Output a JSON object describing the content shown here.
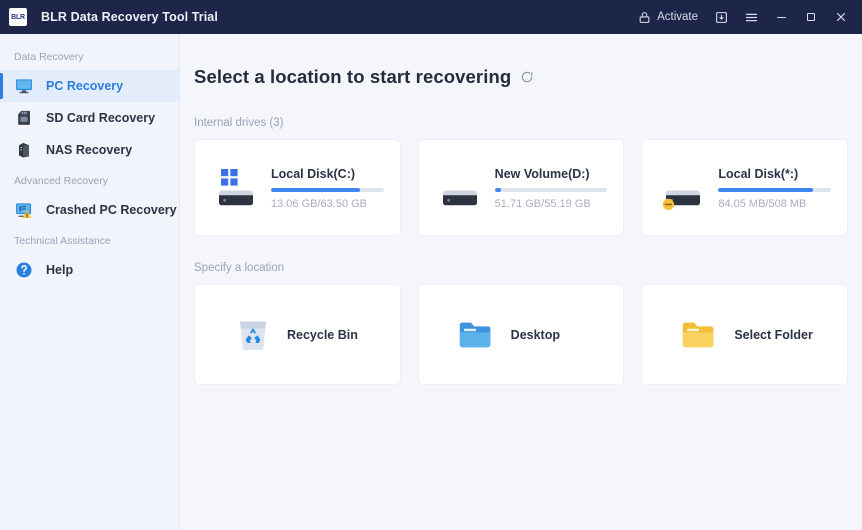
{
  "window": {
    "logo_text": "BLR",
    "title": "BLR Data Recovery Tool Trial",
    "titlebar_bg": "#1d2548",
    "activate_label": "Activate",
    "icons": {
      "lock": "lock-icon",
      "download": "download-icon",
      "menu": "hamburger-menu-icon",
      "minimize": "minimize-icon",
      "maximize": "maximize-icon",
      "close": "close-icon"
    }
  },
  "sidebar": {
    "groups": [
      {
        "label": "Data Recovery",
        "items": [
          {
            "label": "PC Recovery",
            "icon": "monitor-icon",
            "active": true
          },
          {
            "label": "SD Card Recovery",
            "icon": "sd-card-icon",
            "active": false
          },
          {
            "label": "NAS Recovery",
            "icon": "nas-server-icon",
            "active": false
          }
        ]
      },
      {
        "label": "Advanced Recovery",
        "items": [
          {
            "label": "Crashed PC Recovery",
            "icon": "monitor-warning-icon",
            "active": false
          }
        ]
      },
      {
        "label": "Technical Assistance",
        "items": [
          {
            "label": "Help",
            "icon": "help-circle-icon",
            "active": false
          }
        ]
      }
    ],
    "accent_color": "#2a7de1",
    "active_bg": "#e3ecfb"
  },
  "main": {
    "page_title": "Select a location to start recovering",
    "refresh_icon": "refresh-icon",
    "internal_section_label": "Internal drives (3)",
    "specify_section_label": "Specify a location",
    "drives": [
      {
        "name": "Local Disk(C:)",
        "size_text": "13.06 GB/63.50 GB",
        "used_percent": 79,
        "icon": "windows-drive-icon",
        "badge": null
      },
      {
        "name": "New Volume(D:)",
        "size_text": "51.71 GB/55.19 GB",
        "used_percent": 6,
        "icon": "drive-icon",
        "badge": null
      },
      {
        "name": "Local Disk(*:)",
        "size_text": "84.05 MB/508 MB",
        "used_percent": 84,
        "icon": "drive-icon",
        "badge": "warning-badge"
      }
    ],
    "places": [
      {
        "label": "Recycle Bin",
        "icon": "recycle-bin-icon"
      },
      {
        "label": "Desktop",
        "icon": "blue-folder-icon"
      },
      {
        "label": "Select Folder",
        "icon": "yellow-folder-icon"
      }
    ],
    "bar_fill_color": "#3d87ee",
    "bar_track_color": "#dfe3ee"
  }
}
